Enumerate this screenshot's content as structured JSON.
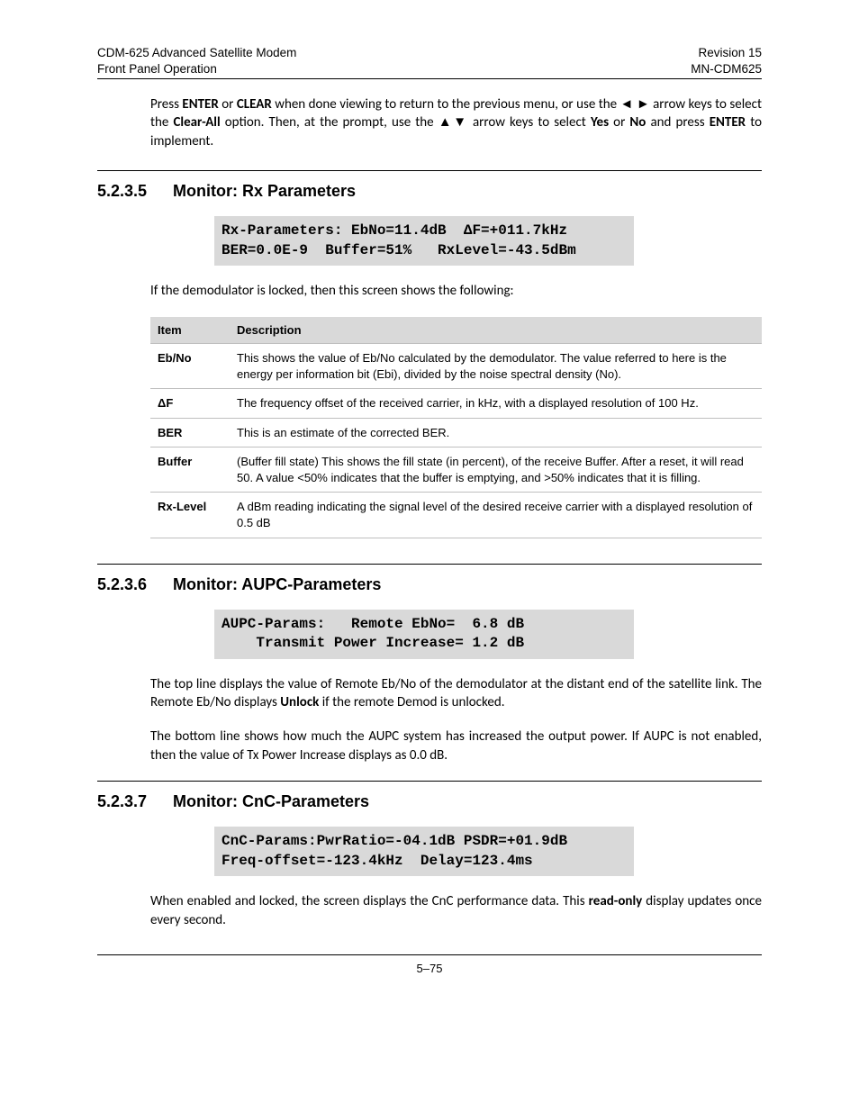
{
  "header": {
    "left1": "CDM-625 Advanced Satellite Modem",
    "left2": "Front Panel Operation",
    "right1": "Revision 15",
    "right2": "MN-CDM625"
  },
  "intro": {
    "t1": "Press ",
    "b1": "ENTER",
    "t2": " or ",
    "b2": "CLEAR",
    "t3": " when done viewing to return to the previous menu, or use the ◄ ► arrow keys to select the ",
    "b3": "Clear-All",
    "t4": " option. Then, at the prompt, use the ▲▼ arrow keys to select ",
    "b4": "Yes",
    "t5": " or ",
    "b5": "No",
    "t6": " and press ",
    "b6": "ENTER",
    "t7": " to implement."
  },
  "sec1": {
    "num": "5.2.3.5",
    "title": "Monitor: Rx Parameters",
    "lcd": "Rx-Parameters: EbNo=11.4dB  ΔF=+011.7kHz\nBER=0.0E-9  Buffer=51%   RxLevel=-43.5dBm",
    "para": "If the demodulator is locked, then this screen shows the following:",
    "th1": "Item",
    "th2": "Description",
    "rows": [
      {
        "item": "Eb/No",
        "desc": "This shows the value of Eb/No calculated by the demodulator. The value referred to here is the energy per information bit (Ebi), divided by the noise spectral density (No)."
      },
      {
        "item": "ΔF",
        "desc": "The frequency offset of the received carrier, in kHz, with a displayed resolution of 100 Hz."
      },
      {
        "item": "BER",
        "desc": "This is an estimate of the corrected BER."
      },
      {
        "item": "Buffer",
        "desc": "(Buffer fill state) This shows the fill state (in percent), of the receive Buffer. After a reset, it will read 50. A value <50% indicates that the buffer is emptying, and >50% indicates that it is filling."
      },
      {
        "item": "Rx-Level",
        "desc": "A dBm reading indicating the signal level of the desired receive carrier with a displayed resolution of 0.5 dB"
      }
    ]
  },
  "sec2": {
    "num": "5.2.3.6",
    "title": "Monitor: AUPC-Parameters",
    "lcd": "AUPC-Params:   Remote EbNo=  6.8 dB\n    Transmit Power Increase= 1.2 dB",
    "p1a": "The top line displays the value of Remote Eb/No of the demodulator at the distant end of the satellite link. The Remote Eb/No displays ",
    "p1b": "Unlock",
    "p1c": " if the remote Demod is unlocked.",
    "p2": "The bottom line shows how much the AUPC system has increased the output power. If AUPC is not enabled, then the value of Tx Power Increase displays as 0.0 dB."
  },
  "sec3": {
    "num": "5.2.3.7",
    "title": "Monitor: CnC-Parameters",
    "lcd": "CnC-Params:PwrRatio=-04.1dB PSDR=+01.9dB\nFreq-offset=-123.4kHz  Delay=123.4ms",
    "p1a": "When enabled and locked, the screen displays the CnC performance data. This ",
    "p1b": "read-only",
    "p1c": " display updates once every second."
  },
  "footer": "5–75"
}
